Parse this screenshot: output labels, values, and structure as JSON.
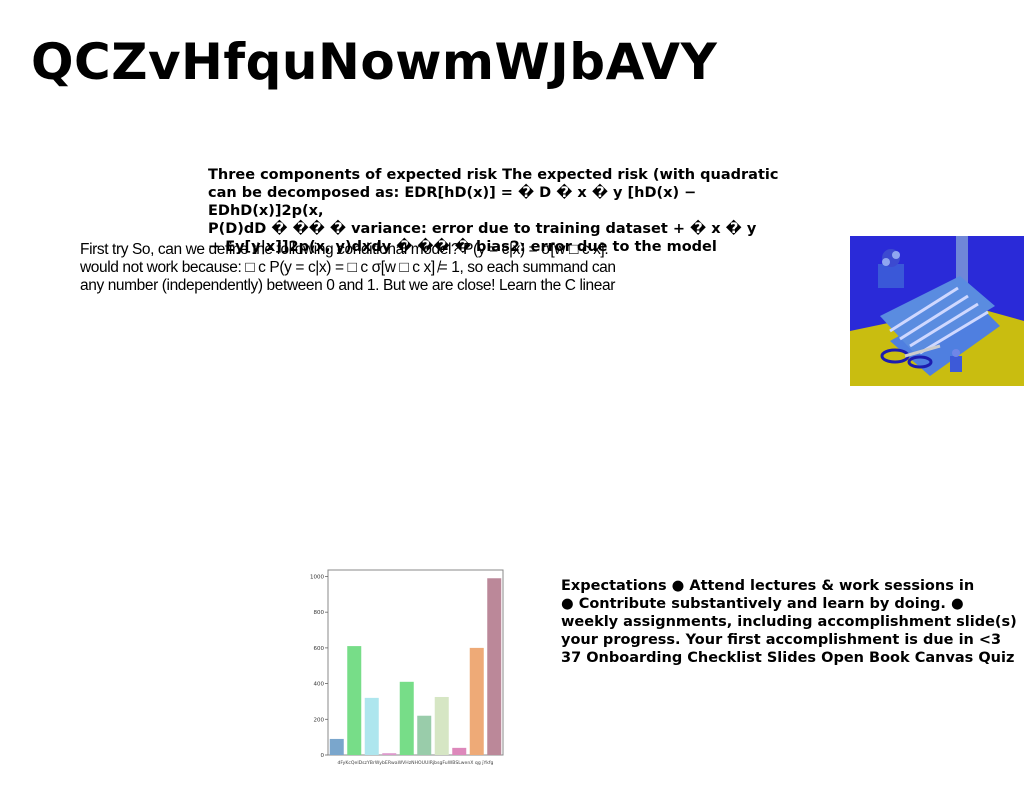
{
  "title": "QCZvHfquNowmWJbAVY",
  "risk_text": "Three components of expected risk The expected risk (with quadratic\ncan be decomposed as: EDR[hD(x)] = � D � x � y [hD(x) − EDhD(x)]2p(x,\nP(D)dD � �� � variance: error due to training dataset + � x � y\n− Ey[y|x]]2p(x, y)dxdy � �� � bias2: error due to the model",
  "model_text": "First try So, can we define the following conditional model? P(y = c|x) = σ[w □ c x].\nwould not work because: □ c P(y = c|x) = □ c σ[w □ c x] ̸= 1, so each summand can\nany number (independently) between 0 and 1. But we are close! Learn the C linear",
  "expectations_text": "Expectations ● Attend lectures & work sessions in\n● Contribute substantively and learn by doing. ●\nweekly assignments, including accomplishment slide(s)\nyour progress. Your first accomplishment is due in <3\n37 Onboarding Checklist Slides Open Book Canvas Quiz",
  "photo": {
    "description_icon": "gift-wrapping-photo",
    "colors": {
      "background": "#c9bd10",
      "wall": "#2a2ad8",
      "paper": "#5a8ce0"
    }
  },
  "chart_data": {
    "type": "bar",
    "categories": [
      "dFyKc",
      "QelDsz",
      "YBrWybE",
      "RwaWVHzN",
      "HOUUI",
      "RjbsgFuW",
      "BSLwenX",
      "qg",
      "jYkfg"
    ],
    "tick_labels_text": "dFyKcQelDszYBrWybERwaWVHzNHOUUIRjbsgFuWBSLwenX qg jYkfg",
    "values": [
      90,
      610,
      320,
      10,
      410,
      220,
      325,
      40,
      600,
      990
    ],
    "bar_colors": [
      "#7aa6cc",
      "#77dd88",
      "#aee6ee",
      "#dd99cc",
      "#77dd88",
      "#99ccaa",
      "#d6e6c4",
      "#dd88bb",
      "#eeaa77",
      "#bb8899"
    ],
    "ylim": [
      0,
      1000
    ],
    "yticks": [
      0,
      200,
      400,
      600,
      800,
      1000
    ],
    "title": "",
    "xlabel": "",
    "ylabel": ""
  }
}
